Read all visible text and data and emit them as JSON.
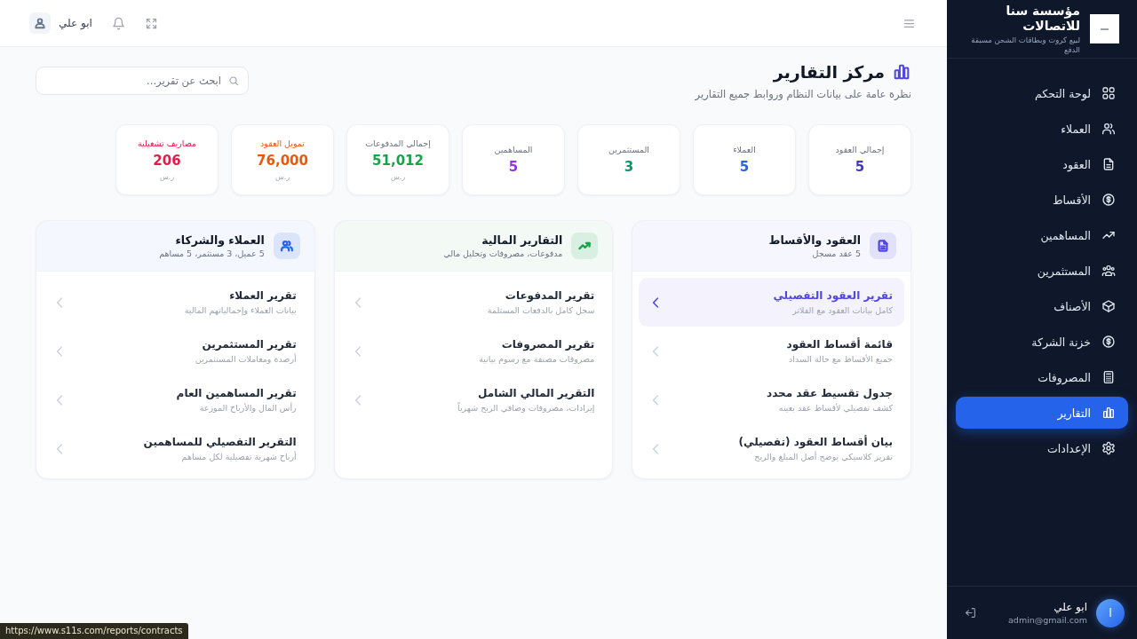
{
  "sidebar": {
    "brand": {
      "title": "مؤسسة سنا للاتصالات",
      "subtitle": "لبيع كروت وبطاقات الشحن مسبقة الدفع"
    },
    "items": [
      {
        "label": "لوحة التحكم",
        "selected": false
      },
      {
        "label": "العملاء",
        "selected": false
      },
      {
        "label": "العقود",
        "selected": false
      },
      {
        "label": "الأقساط",
        "selected": false
      },
      {
        "label": "المساهمين",
        "selected": false
      },
      {
        "label": "المستثمرين",
        "selected": false
      },
      {
        "label": "الأصناف",
        "selected": false
      },
      {
        "label": "خزنة الشركة",
        "selected": false
      },
      {
        "label": "المصروفات",
        "selected": false
      },
      {
        "label": "التقارير",
        "selected": true
      },
      {
        "label": "الإعدادات",
        "selected": false
      }
    ],
    "user": {
      "avatar_letter": "ا",
      "name": "ابو علي",
      "email": "admin@gmail.com"
    }
  },
  "header": {
    "user_name": "ابو علي"
  },
  "page": {
    "title": "مركز التقارير",
    "subtitle": "نظرة عامة على بيانات النظام وروابط جميع التقارير",
    "search": {
      "placeholder": "ابحث عن تقرير..."
    }
  },
  "stats": [
    {
      "label": "إجمالي العقود",
      "value": "5",
      "color": "#4338ca",
      "accent_label": false
    },
    {
      "label": "العملاء",
      "value": "5",
      "color": "#2563eb",
      "accent_label": false
    },
    {
      "label": "المستثمرين",
      "value": "3",
      "color": "#059669",
      "accent_label": false
    },
    {
      "label": "المساهمين",
      "value": "5",
      "color": "#9333ea",
      "accent_label": false
    },
    {
      "label": "إجمالي المدفوعات",
      "value": "51,012",
      "unit": "ر.س",
      "color": "#16a34a",
      "accent_label": false
    },
    {
      "label": "تمويل العقود",
      "value": "76,000",
      "unit": "ر.س",
      "color": "#ea580c",
      "accent_label": true
    },
    {
      "label": "مصاريف تشغيلية",
      "value": "206",
      "unit": "ر.س",
      "color": "#e11d48",
      "accent_label": true
    }
  ],
  "panels": [
    {
      "title": "العقود والأقساط",
      "subtitle": "5 عقد مسجل",
      "color": "#4f46e5",
      "reports": [
        {
          "title": "تقرير العقود التفصيلي",
          "description": "كامل بيانات العقود مع الفلاتر",
          "hovered": true
        },
        {
          "title": "قائمة أقساط العقود",
          "description": "جميع الأقساط مع حالة السداد",
          "hovered": false
        },
        {
          "title": "جدول تقسيط عقد محدد",
          "description": "كشف تفصيلي لأقساط عقد بعينه",
          "hovered": false
        },
        {
          "title": "بيان أقساط العقود (تفصيلي)",
          "description": "تقرير كلاسيكي يوضح أصل المبلغ والربح",
          "hovered": false
        }
      ]
    },
    {
      "title": "التقارير المالية",
      "subtitle": "مدفوعات، مصروفات وتحليل مالي",
      "color": "#16a34a",
      "reports": [
        {
          "title": "تقرير المدفوعات",
          "description": "سجل كامل بالدفعات المستلمة",
          "hovered": false
        },
        {
          "title": "تقرير المصروفات",
          "description": "مصروفات مصنفة مع رسوم بيانية",
          "hovered": false
        },
        {
          "title": "التقرير المالي الشامل",
          "description": "إيرادات، مصروفات وصافي الربح شهرياً",
          "hovered": false
        }
      ]
    },
    {
      "title": "العملاء والشركاء",
      "subtitle": "5 عميل، 3 مستثمر، 5 مساهم",
      "color": "#2563eb",
      "reports": [
        {
          "title": "تقرير العملاء",
          "description": "بيانات العملاء وإجمالياتهم المالية",
          "hovered": false
        },
        {
          "title": "تقرير المستثمرين",
          "description": "أرصدة ومعاملات المستثمرين",
          "hovered": false
        },
        {
          "title": "تقرير المساهمين العام",
          "description": "رأس المال والأرباح الموزعة",
          "hovered": false
        },
        {
          "title": "التقرير التفصيلي للمساهمين",
          "description": "أرباح شهرية تفصيلية لكل مساهم",
          "hovered": false
        }
      ]
    }
  ],
  "status_bar": {
    "url": "https://www.s11s.com/reports/contracts"
  }
}
